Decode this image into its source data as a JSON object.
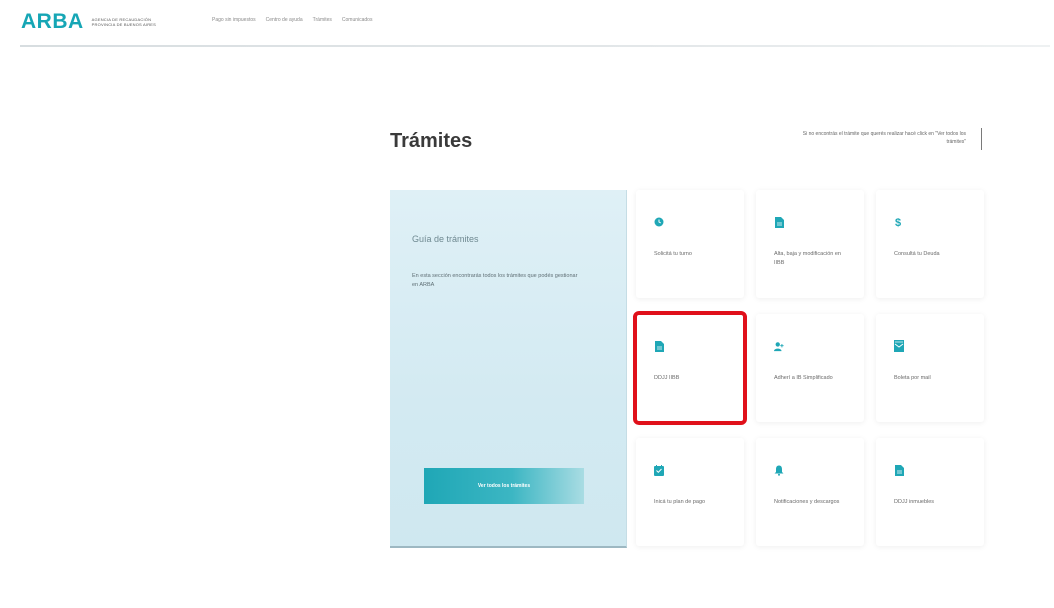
{
  "header": {
    "logo": "ARBA",
    "logo_sub": [
      "AGENCIA DE RECAUDACIÓN",
      "PROVINCIA DE BUENOS AIRES"
    ],
    "nav": [
      "Pago sin impuestos",
      "Centro de ayuda",
      "Trámites",
      "Comunicados"
    ]
  },
  "page": {
    "title": "Trámites",
    "help_text": "Si no encontrás el trámite que querés realizar hacé click en \"Ver todos los trámites\""
  },
  "guide": {
    "title": "Guía de trámites",
    "description": "En esta sección encontrarás todos los trámites que podés gestionar en ARBA",
    "button_label": "Ver todos los trámites"
  },
  "tiles": [
    {
      "label": "Solicitá tu turno",
      "icon": "clock-icon"
    },
    {
      "label": "Alta, baja y modificación en IIBB",
      "icon": "document-icon"
    },
    {
      "label": "Consultá tu Deuda",
      "icon": "dollar-icon"
    },
    {
      "label": "DDJJ IIBB",
      "icon": "document-icon"
    },
    {
      "label": "Adherí a IB Simplificado",
      "icon": "user-add-icon"
    },
    {
      "label": "Boleta por mail",
      "icon": "envelope-icon"
    },
    {
      "label": "Inicá tu plan de pago",
      "icon": "calendar-icon"
    },
    {
      "label": "Notificaciones y descargos",
      "icon": "bell-icon"
    },
    {
      "label": "DDJJ inmuebles",
      "icon": "document-icon"
    }
  ],
  "colors": {
    "brand": "#16a6b5",
    "highlight": "#e0101a"
  }
}
